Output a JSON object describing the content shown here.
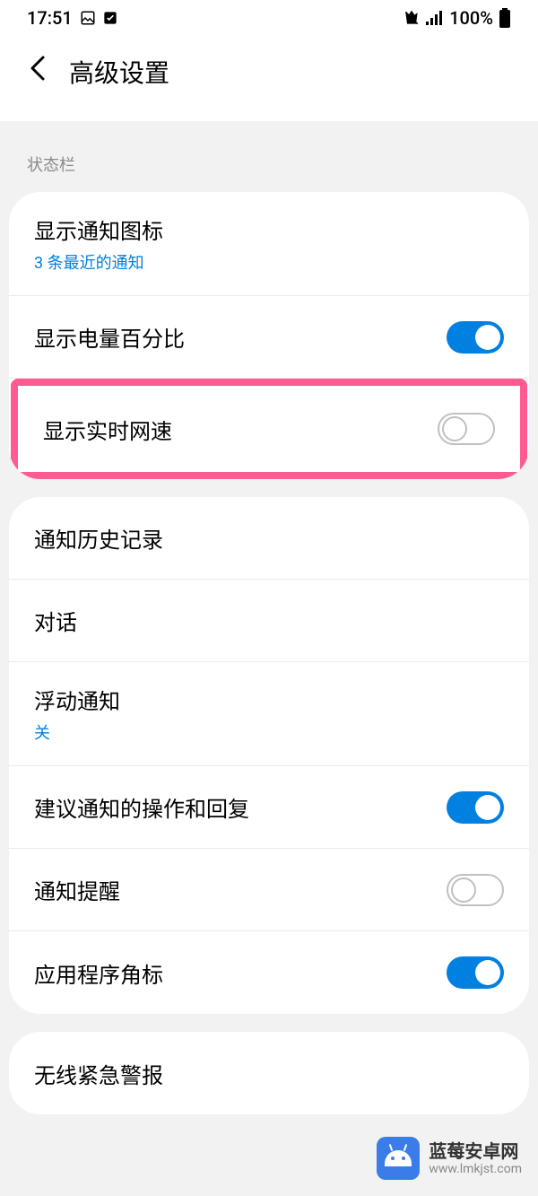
{
  "statusbar": {
    "time": "17:51",
    "battery": "100%"
  },
  "header": {
    "title": "高级设置"
  },
  "section1": {
    "label": "状态栏",
    "rows": {
      "notif_icons": {
        "title": "显示通知图标",
        "sub": "3 条最近的通知"
      },
      "battery_pct": {
        "title": "显示电量百分比"
      },
      "net_speed": {
        "title": "显示实时网速"
      }
    }
  },
  "section2": {
    "rows": {
      "history": {
        "title": "通知历史记录"
      },
      "conversations": {
        "title": "对话"
      },
      "floating": {
        "title": "浮动通知",
        "sub": "关"
      },
      "suggest": {
        "title": "建议通知的操作和回复"
      },
      "reminder": {
        "title": "通知提醒"
      },
      "badge": {
        "title": "应用程序角标"
      }
    }
  },
  "section3": {
    "rows": {
      "emergency": {
        "title": "无线紧急警报"
      }
    }
  },
  "watermark": {
    "line1": "蓝莓安卓网",
    "line2": "www.lmkjst.com"
  }
}
